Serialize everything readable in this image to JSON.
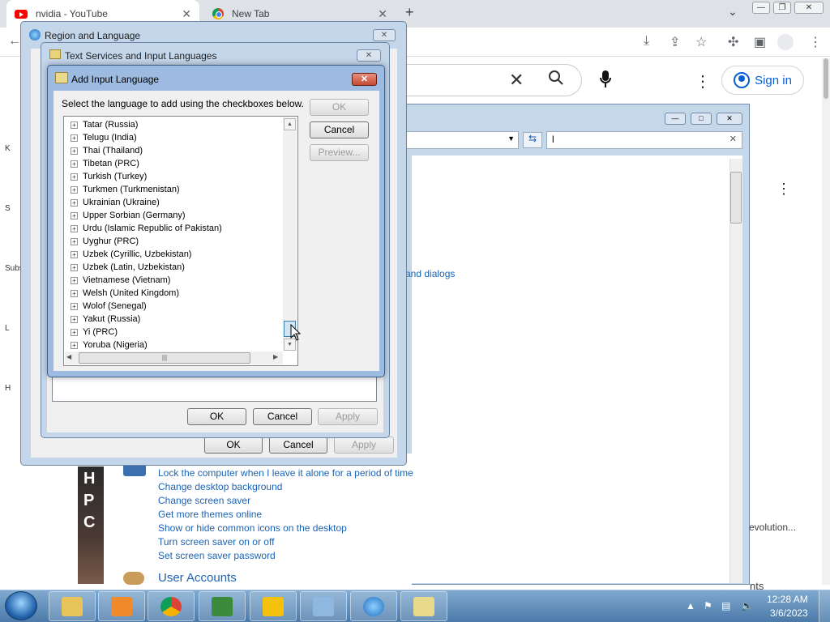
{
  "browser": {
    "tabs": [
      {
        "label": "nvidia - YouTube",
        "close": "✕"
      },
      {
        "label": "New Tab",
        "close": "✕"
      }
    ],
    "new_tab": "+",
    "chevron": "⌄",
    "window_min": "—",
    "window_restore": "❐",
    "window_close": "✕"
  },
  "youtube": {
    "search_clear": "✕",
    "signin_label": "Sign in",
    "menu_dots": "⋮",
    "video_title_snippet": "evolution...",
    "side_snippet": "nts",
    "thumb_letters": [
      "H",
      "P",
      "C"
    ],
    "side_letters": [
      "K",
      "S",
      "Subs",
      "L",
      "H"
    ]
  },
  "control_panel": {
    "search_value": "l",
    "search_clear": "✕",
    "menu_dots": "⋮",
    "dialogs_link": "and dialogs",
    "links": [
      "Lock the computer when I leave it alone for a period of time",
      "Change desktop background",
      "Change screen saver",
      "Get more themes online",
      "Show or hide common icons on the desktop",
      "Turn screen saver on or off",
      "Set screen saver password"
    ],
    "user_accounts": "User Accounts"
  },
  "region_language": {
    "title": "Region and Language",
    "close": "✕",
    "ok": "OK",
    "cancel": "Cancel",
    "apply": "Apply"
  },
  "text_services": {
    "title": "Text Services and Input Languages",
    "close": "✕",
    "ok": "OK",
    "cancel": "Cancel",
    "apply": "Apply"
  },
  "add_input_language": {
    "title": "Add Input Language",
    "close": "✕",
    "instruction": "Select the language to add using the checkboxes below.",
    "ok": "OK",
    "cancel": "Cancel",
    "preview": "Preview...",
    "languages": [
      "Tatar (Russia)",
      "Telugu (India)",
      "Thai (Thailand)",
      "Tibetan (PRC)",
      "Turkish (Turkey)",
      "Turkmen (Turkmenistan)",
      "Ukrainian (Ukraine)",
      "Upper Sorbian (Germany)",
      "Urdu (Islamic Republic of Pakistan)",
      "Uyghur (PRC)",
      "Uzbek (Cyrillic, Uzbekistan)",
      "Uzbek (Latin, Uzbekistan)",
      "Vietnamese (Vietnam)",
      "Welsh (United Kingdom)",
      "Wolof (Senegal)",
      "Yakut (Russia)",
      "Yi (PRC)",
      "Yoruba (Nigeria)"
    ],
    "expander": "+"
  },
  "taskbar": {
    "time": "12:28 AM",
    "date": "3/6/2023",
    "apps": [
      "file-explorer",
      "media-player",
      "chrome",
      "csharp-editor",
      "sticky-app",
      "control-panel",
      "network-globe",
      "region-language"
    ],
    "accent": "#4c7aa9"
  }
}
